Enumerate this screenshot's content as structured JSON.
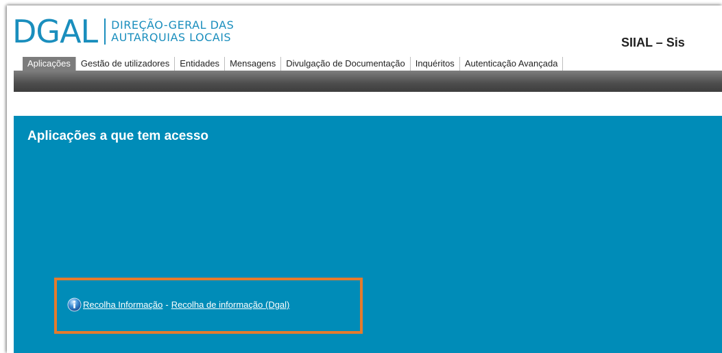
{
  "header": {
    "logo_mark": "DGAL",
    "logo_line1": "DIREÇÃO-GERAL DAS",
    "logo_line2": "AUTARQUIAS LOCAIS",
    "app_title": "SIIAL – Sis"
  },
  "nav": {
    "items": [
      {
        "label": "Aplicações",
        "active": true
      },
      {
        "label": "Gestão de utilizadores"
      },
      {
        "label": "Entidades"
      },
      {
        "label": "Mensagens"
      },
      {
        "label": "Divulgação de Documentação"
      },
      {
        "label": "Inquéritos"
      },
      {
        "label": "Autenticação Avançada"
      }
    ]
  },
  "main": {
    "title": "Aplicações a que tem acesso",
    "apps": [
      {
        "icon": "info-icon",
        "name": "Recolha Informação",
        "separator": "-",
        "description": "Recolha de informação (Dgal)"
      }
    ]
  },
  "colors": {
    "brand": "#1a8ebd",
    "panel": "#008cb8",
    "highlight": "#e57b2c",
    "active_tab": "#7c7c7c"
  }
}
